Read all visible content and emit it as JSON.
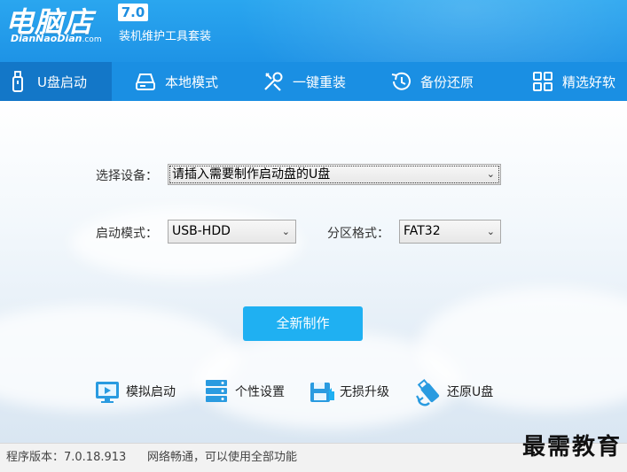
{
  "header": {
    "logo_text": "电脑店",
    "logo_subtitle": "DianNaoDian",
    "logo_domain": ".com",
    "version_badge": "7.0",
    "tagline": "装机维护工具套装"
  },
  "nav": {
    "items": [
      {
        "label": "U盘启动",
        "icon": "usb-drive-icon",
        "active": true
      },
      {
        "label": "本地模式",
        "icon": "hard-drive-icon",
        "active": false
      },
      {
        "label": "一键重装",
        "icon": "tools-icon",
        "active": false
      },
      {
        "label": "备份还原",
        "icon": "history-icon",
        "active": false
      },
      {
        "label": "精选好软",
        "icon": "apps-grid-icon",
        "active": false
      }
    ]
  },
  "form": {
    "device_label": "选择设备：",
    "device_value": "请插入需要制作启动盘的U盘",
    "boot_mode_label": "启动模式：",
    "boot_mode_value": "USB-HDD",
    "partition_label": "分区格式：",
    "partition_value": "FAT32"
  },
  "actions": {
    "create_label": "全新制作"
  },
  "tools": [
    {
      "label": "模拟启动",
      "icon": "monitor-simulate-icon"
    },
    {
      "label": "个性设置",
      "icon": "settings-server-icon"
    },
    {
      "label": "无损升级",
      "icon": "upgrade-icon"
    },
    {
      "label": "还原U盘",
      "icon": "restore-usb-icon"
    }
  ],
  "status": {
    "version_text": "程序版本：7.0.18.913",
    "network_text": "网络畅通，可以使用全部功能"
  },
  "watermark": "最需教育",
  "colors": {
    "header": "#1e93e6",
    "nav": "#1a8fe3",
    "nav_active": "#1377c8",
    "primary_button": "#1fb0f2"
  }
}
